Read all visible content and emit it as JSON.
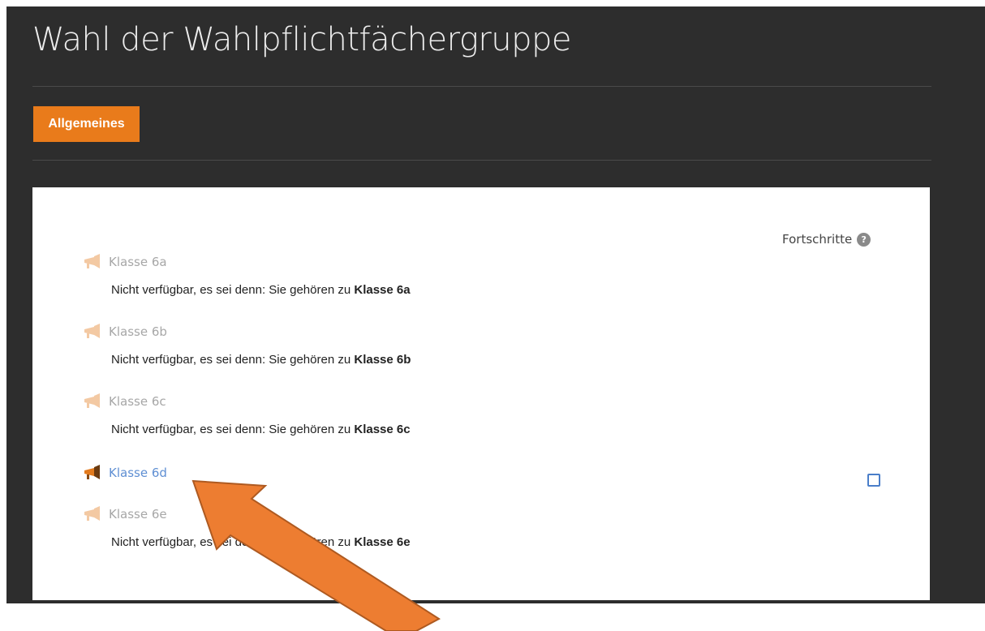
{
  "page": {
    "title": "Wahl der Wahlpflichtfächergruppe",
    "section_label": "Allgemeines"
  },
  "card": {
    "progress_label": "Fortschritte",
    "progress_help_icon": "question-circle-icon",
    "activities": [
      {
        "label": "Klasse 6a",
        "available": false,
        "restriction_prefix": "Nicht verfügbar, es sei denn: Sie gehören zu",
        "restriction_group": "Klasse 6a"
      },
      {
        "label": "Klasse 6b",
        "available": false,
        "restriction_prefix": "Nicht verfügbar, es sei denn: Sie gehören zu",
        "restriction_group": "Klasse 6b"
      },
      {
        "label": "Klasse 6c",
        "available": false,
        "restriction_prefix": "Nicht verfügbar, es sei denn: Sie gehören zu",
        "restriction_group": "Klasse 6c"
      },
      {
        "label": "Klasse 6d",
        "available": true,
        "completion_checked": false
      },
      {
        "label": "Klasse 6e",
        "available": false,
        "restriction_prefix": "Nicht verfügbar, es sei denn: Sie gehören zu",
        "restriction_group": "Klasse 6e"
      }
    ]
  },
  "colors": {
    "background_dark": "#2d2d2d",
    "accent_orange": "#e97b1b",
    "link_blue": "#5f8fd3",
    "disabled_gray": "#a7a7a7",
    "annotation_arrow": "#ed7d31"
  },
  "icons": {
    "activity": "megaphone-icon",
    "annotation": "arrow-annotation"
  }
}
